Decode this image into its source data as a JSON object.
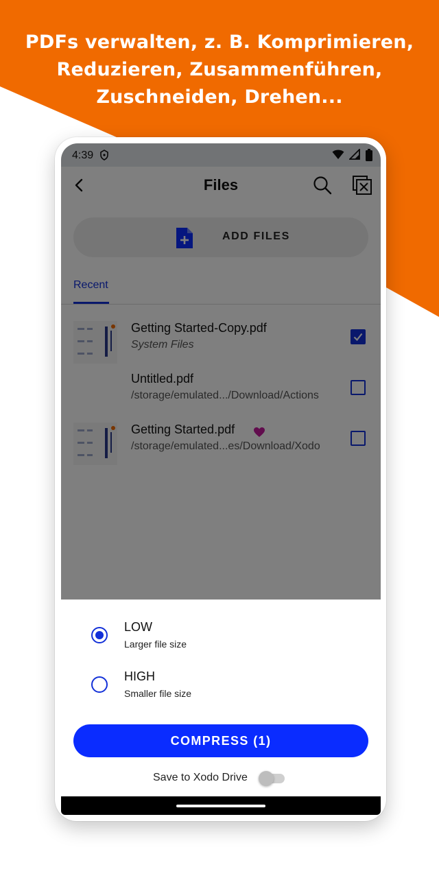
{
  "colors": {
    "brand_orange": "#f06a00",
    "accent_blue": "#0a2cff",
    "favorite": "#c2189b"
  },
  "headline": {
    "line1": "PDFs verwalten, z. B. Komprimieren,",
    "line2": "Reduzieren, Zusammenführen,",
    "line3": "Zuschneiden, Drehen..."
  },
  "status_bar": {
    "time": "4:39",
    "icons": [
      "lock-icon",
      "wifi-icon",
      "signal-icon",
      "battery-icon"
    ]
  },
  "toolbar": {
    "title": "Files",
    "icons": [
      "back-arrow-icon",
      "search-icon",
      "close-selection-icon"
    ]
  },
  "add_files": {
    "label": "ADD FILES",
    "icon": "add-file-icon"
  },
  "tabs": {
    "recent": "Recent"
  },
  "files": [
    {
      "name": "Getting Started-Copy.pdf",
      "path": "System Files",
      "checked": true,
      "favorite": false
    },
    {
      "name": "Untitled.pdf",
      "path": "/storage/emulated.../Download/Actions",
      "checked": false,
      "favorite": false
    },
    {
      "name": "Getting Started.pdf",
      "path": "/storage/emulated...es/Download/Xodo",
      "checked": false,
      "favorite": true
    }
  ],
  "compression_options": [
    {
      "label": "LOW",
      "sub": "Larger file size",
      "selected": true
    },
    {
      "label": "HIGH",
      "sub": "Smaller file size",
      "selected": false
    }
  ],
  "compress_button": {
    "label": "COMPRESS (1)"
  },
  "save_to_drive": {
    "label": "Save to Xodo Drive",
    "enabled": false
  }
}
